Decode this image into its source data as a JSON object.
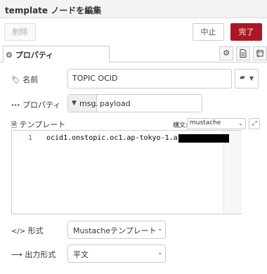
{
  "header": {
    "title": "template ノードを編集"
  },
  "toolbar": {
    "delete_label": "削除",
    "cancel_label": "中止",
    "done_label": "完了"
  },
  "tabs": {
    "properties_label": "プロパティ",
    "icons": [
      "gear-icon",
      "document-icon",
      "frame-icon"
    ]
  },
  "fields": {
    "name": {
      "label": "名前",
      "value": "TOPIC OCID"
    },
    "property": {
      "label": "プロパティ",
      "prefix": "msg.",
      "value": "payload"
    },
    "template": {
      "label": "テンプレート",
      "syntax_label": "構文:",
      "syntax_value": "mustache"
    },
    "format": {
      "label": "形式",
      "value": "Mustacheテンプレート"
    },
    "output": {
      "label": "出力形式",
      "value": "平文"
    }
  },
  "editor": {
    "line_number": "1",
    "line_text": "ocid1.onstopic.oc1.ap-tokyo-1.a"
  },
  "colors": {
    "done_button": "#ad1625",
    "header_bg": "#f3f3f3"
  }
}
